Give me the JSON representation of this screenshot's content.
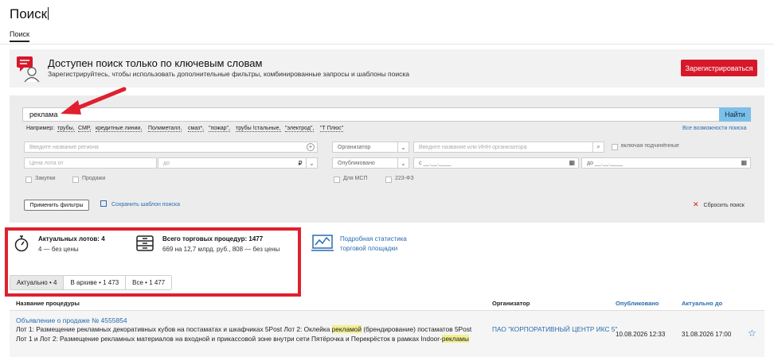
{
  "header": {
    "title": "Поиск",
    "tab_search": "Поиск"
  },
  "banner": {
    "title": "Доступен поиск только по ключевым словам",
    "subtitle": "Зарегистрируйтесь, чтобы использовать дополнительные фильтры, комбинированные запросы и шаблоны поиска",
    "register_label": "Зарегистрироваться",
    "icon": "chat-user-icon"
  },
  "search": {
    "query_value": "реклама",
    "find_label": "Найти",
    "examples_label": "Например:",
    "examples": [
      "трубы,",
      "СМР,",
      "кредитные линии,",
      "Полиметалл,",
      "смаз*,",
      "\"пожар\",",
      "трубы !стальные,",
      "\"электрод\",",
      "\"Т Плюс\""
    ],
    "all_options_label": "Все возможности поиска"
  },
  "filters": {
    "region_placeholder": "Введите название региона",
    "organizer_select": "Организатор",
    "organizer_placeholder": "Введите название или ИНН организатора",
    "include_subordinate": "включая подчинённые",
    "price_from_placeholder": "Цена лота от",
    "price_to_placeholder": "до",
    "currency": "₽",
    "published_select": "Опубликовано",
    "date_from": "с  __.__.____",
    "date_to": "до  __.__.____",
    "purchases_label": "Закупки",
    "sales_label": "Продажи",
    "msp_label": "Для МСП",
    "fz223_label": "223-ФЗ",
    "apply_label": "Применить фильтры",
    "save_template_label": "Сохранить шаблон поиска",
    "reset_label": "Сбросить поиск"
  },
  "stats": {
    "active_lots_title": "Актуальных лотов: 4",
    "active_lots_sub": "4 — без цены",
    "total_procedures_title": "Всего торговых процедур: 1477",
    "total_procedures_sub": "669 на 12,7 млрд. руб., 808 — без цены",
    "stats_link_line1": "Подробная статистика",
    "stats_link_line2": "торговой площадки",
    "segments": [
      "Актуально • 4",
      "В архиве • 1 473",
      "Все • 1 477"
    ]
  },
  "table": {
    "headers": {
      "name": "Название процедуры",
      "organizer": "Организатор",
      "published": "Опубликовано",
      "actual_until": "Актуально до"
    },
    "rows": [
      {
        "title": "Объявление о продаже № 4555854",
        "desc_part1": "Лот 1: Размещение рекламных декоративных кубов на постаматах и шкафчиках 5Post Лот 2: Оклейка ",
        "desc_hl1": "рекламой",
        "desc_part2": " (брендирование) постаматов 5Post Лот 1 и Лот 2: Размещение рекламных материалов на входной и прикассовой зоне внутри сети Пятёрочка и Перекрёсток в рамках Indoor-",
        "desc_hl2": "рекламы",
        "organizer": "ПАО \"КОРПОРАТИВНЫЙ ЦЕНТР ИКС 5\"",
        "published": "10.08.2026 12:33",
        "actual_until": "31.08.2026 17:00"
      }
    ]
  },
  "colors": {
    "accent_red": "#d6182a",
    "link_blue": "#2a6cb0",
    "find_button": "#7cc0ea",
    "highlight": "#f3f091"
  }
}
